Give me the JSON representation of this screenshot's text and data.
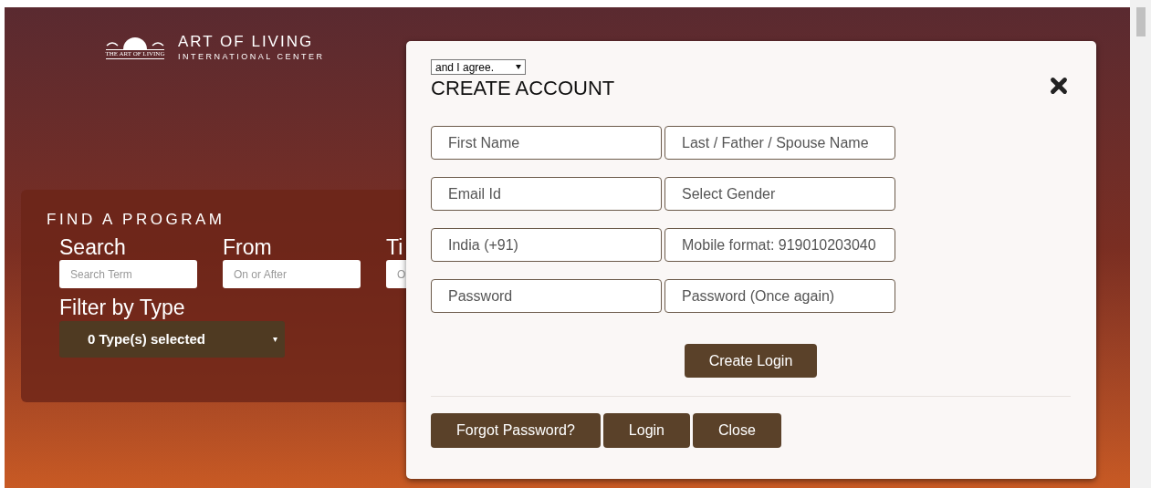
{
  "header": {
    "logo_caption": "THE ART OF LIVING",
    "title": "ART OF LIVING",
    "subtitle": "INTERNATIONAL CENTER"
  },
  "find_program": {
    "heading": "FIND A PROGRAM",
    "fields": [
      {
        "label": "Search",
        "placeholder": "Search Term"
      },
      {
        "label": "From",
        "placeholder": "On or After"
      },
      {
        "label": "Ti",
        "placeholder": "O"
      }
    ],
    "filter": {
      "label": "Filter by Type",
      "value": "0 Type(s) selected"
    }
  },
  "modal": {
    "agree_select": "and I agree.",
    "title": "CREATE ACCOUNT",
    "fields": [
      {
        "placeholder": "First Name"
      },
      {
        "placeholder": "Last / Father / Spouse Name"
      },
      {
        "placeholder": "Email Id"
      },
      {
        "placeholder": "Select Gender"
      },
      {
        "placeholder": "India (+91)"
      },
      {
        "placeholder": "Mobile format: 919010203040"
      },
      {
        "placeholder": "Password"
      },
      {
        "placeholder": "Password (Once again)"
      }
    ],
    "submit": "Create Login",
    "buttons": [
      "Forgot Password?",
      "Login",
      "Close"
    ]
  }
}
